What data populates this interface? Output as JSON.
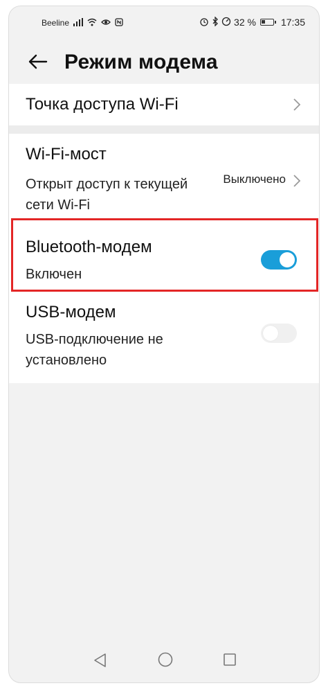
{
  "statusbar": {
    "carrier": "Beeline",
    "battery_text": "32 %",
    "battery_level": 0.32,
    "time": "17:35",
    "icons": [
      "signal-icon",
      "wifi-icon",
      "eye-icon",
      "nfc-icon",
      "alarm-icon",
      "bluetooth-icon",
      "speed-icon",
      "battery-icon"
    ]
  },
  "header": {
    "title": "Режим модема",
    "back_icon": "arrow-left-icon"
  },
  "settings": {
    "hotspot": {
      "label": "Точка доступа Wi-Fi"
    },
    "bridge": {
      "label": "Wi-Fi-мост",
      "description": "Открыт доступ к текущей сети Wi-Fi",
      "status": "Выключено"
    },
    "bluetooth": {
      "label": "Bluetooth-модем",
      "description": "Включен",
      "enabled": true
    },
    "usb": {
      "label": "USB-модем",
      "description": "USB-подключение не установлено",
      "enabled": false
    }
  },
  "colors": {
    "accent": "#1a9ed9",
    "highlight": "#e32626",
    "background": "#f2f2f2"
  },
  "navbar": {
    "icons": [
      "triangle-back-icon",
      "circle-home-icon",
      "square-recents-icon"
    ]
  }
}
